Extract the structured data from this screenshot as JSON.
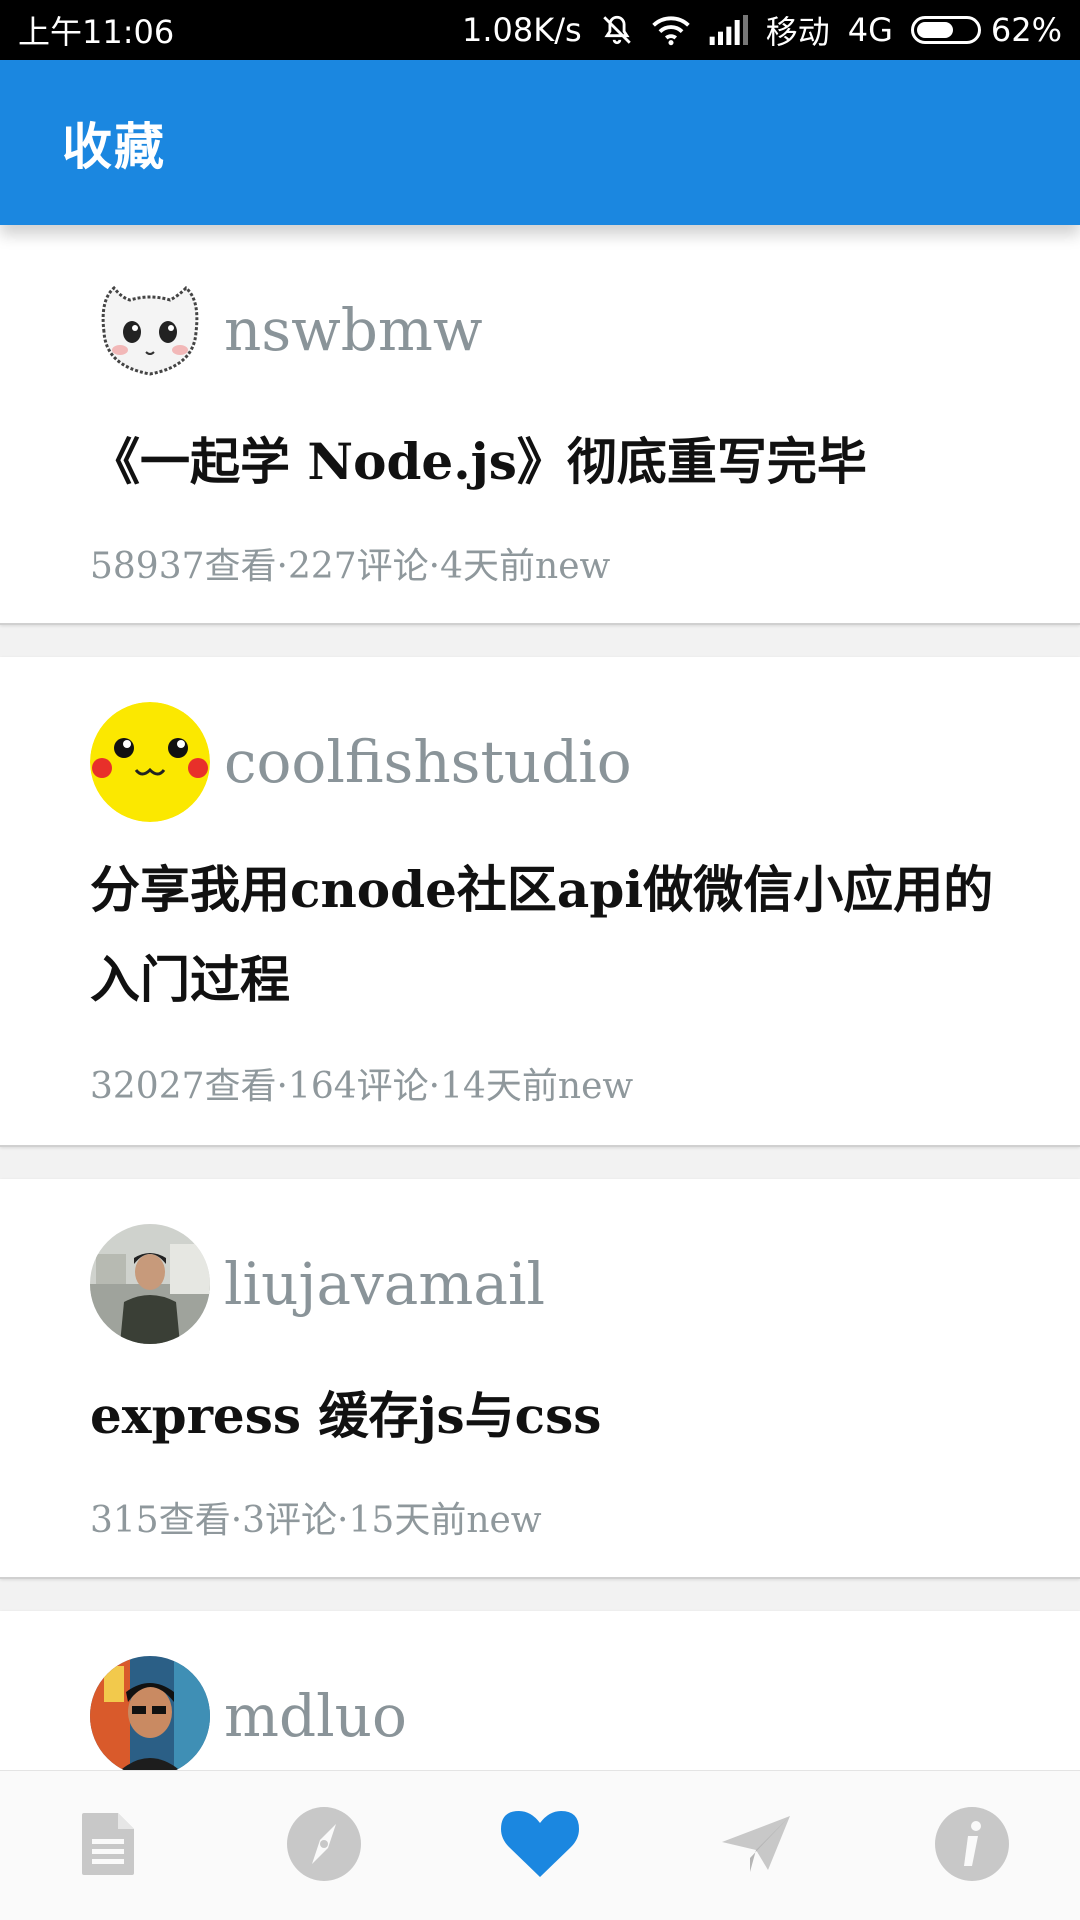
{
  "status_bar": {
    "time": "上午11:06",
    "speed": "1.08K/s",
    "carrier": "移动",
    "network": "4G",
    "battery": "62%",
    "battery_level": 0.62,
    "icons": [
      "mute-icon",
      "wifi-icon",
      "signal-icon",
      "battery-icon"
    ]
  },
  "app_bar": {
    "title": "收藏",
    "color": "#1b87e0"
  },
  "posts": [
    {
      "author": "nswbmw",
      "title": "《一起学 Node.js》彻底重写完毕",
      "meta": "58937查看·227评论·4天前new"
    },
    {
      "author": "coolfishstudio",
      "title": "分享我用cnode社区api做微信小应用的入门过程",
      "meta": "32027查看·164评论·14天前new"
    },
    {
      "author": "liujavamail",
      "title": "express 缓存js与css",
      "meta": "315查看·3评论·15天前new"
    },
    {
      "author": "mdluo",
      "title": "",
      "meta": ""
    }
  ],
  "bottom_nav": {
    "items": [
      "topics-icon",
      "explore-compass-icon",
      "favorites-heart-icon",
      "send-plane-icon",
      "about-info-icon"
    ],
    "active": "favorites-heart-icon",
    "active_color": "#1b87e0",
    "inactive_color": "#c8c8c8"
  }
}
